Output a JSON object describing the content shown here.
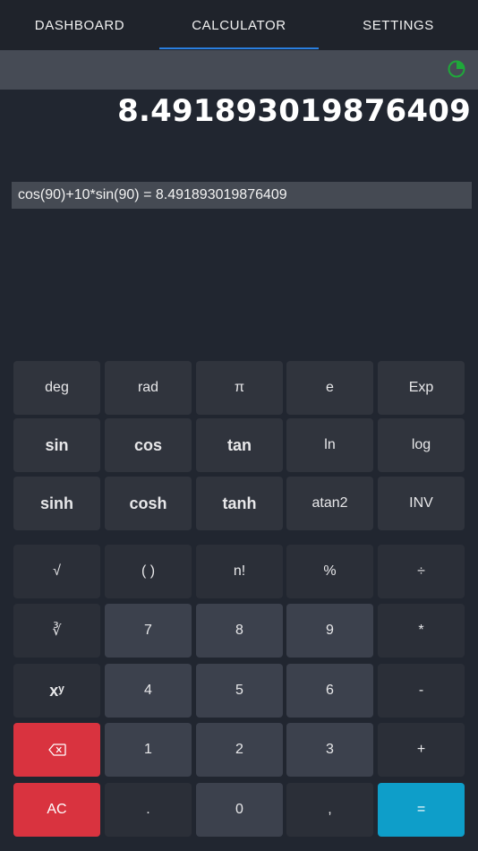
{
  "tabs": [
    {
      "label": "DASHBOARD"
    },
    {
      "label": "CALCULATOR"
    },
    {
      "label": "SETTINGS"
    }
  ],
  "active_tab": "CALCULATOR",
  "history_icon": "history-clock-icon",
  "display": {
    "result": "8.491893019876409",
    "expression": "cos(90)+10*sin(90) = 8.491893019876409"
  },
  "scientific_keys": [
    [
      "deg",
      "rad",
      "π",
      "e",
      "Exp"
    ],
    [
      "sin",
      "cos",
      "tan",
      "ln",
      "log"
    ],
    [
      "sinh",
      "cosh",
      "tanh",
      "atan2",
      "INV"
    ]
  ],
  "keypad": [
    [
      "√",
      "( )",
      "n!",
      "%",
      "÷"
    ],
    [
      "∛",
      "7",
      "8",
      "9",
      "*"
    ],
    [
      "xʸ",
      "4",
      "5",
      "6",
      "-"
    ],
    [
      "",
      "1",
      "2",
      "3",
      "+"
    ],
    [
      "AC",
      ".",
      "0",
      ",",
      "="
    ]
  ],
  "backspace_icon": "backspace-icon",
  "colors": {
    "background": "#212630",
    "accent_tab": "#2a7fe0",
    "history_icon": "#1fa83a",
    "delete_key": "#d9333f",
    "equals_key": "#0e9ec9"
  }
}
